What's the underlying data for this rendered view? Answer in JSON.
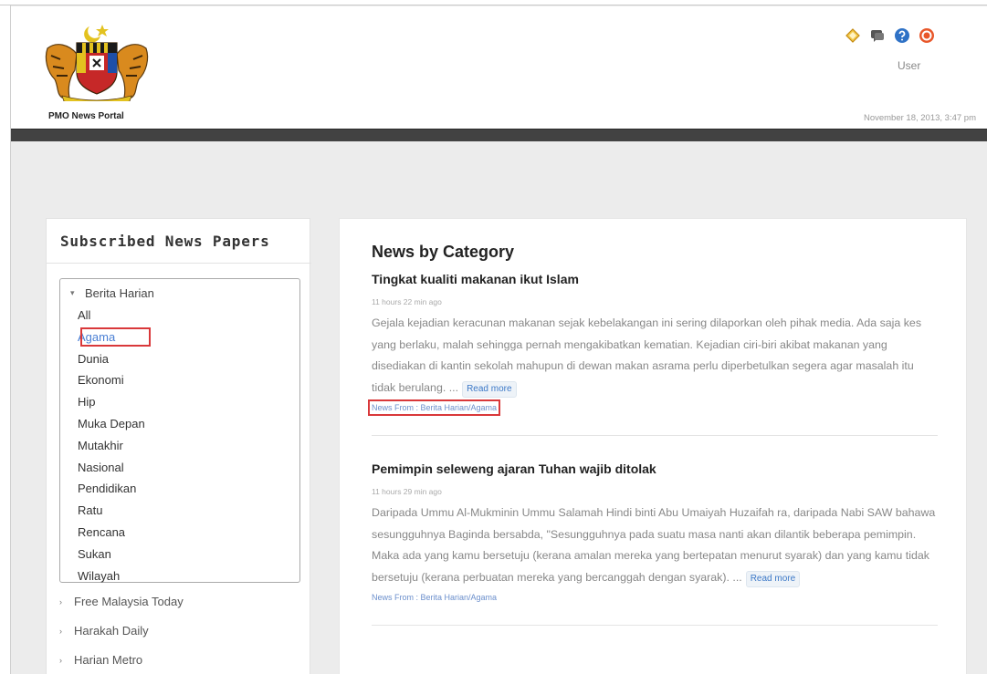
{
  "header": {
    "site_title": "PMO News Portal",
    "user_label": "User",
    "datetime": "November 18, 2013, 3:47 pm",
    "icons": [
      "home-icon",
      "chat-icon",
      "help-icon",
      "logout-icon"
    ]
  },
  "sidebar": {
    "heading": "Subscribed News Papers",
    "expanded_paper": "Berita Harian",
    "categories": [
      "All",
      "Agama",
      "Dunia",
      "Ekonomi",
      "Hip",
      "Muka Depan",
      "Mutakhir",
      "Nasional",
      "Pendidikan",
      "Ratu",
      "Rencana",
      "Sukan",
      "Wilayah"
    ],
    "active_category": "Agama",
    "other_papers": [
      "Free Malaysia Today",
      "Harakah Daily",
      "Harian Metro"
    ]
  },
  "main": {
    "heading": "News by Category",
    "read_more_label": "Read more",
    "articles": [
      {
        "title": "Tingkat kualiti makanan ikut Islam",
        "time": "11 hours 22 min ago",
        "body": "Gejala kejadian keracunan makanan sejak kebelakangan ini sering dilaporkan oleh pihak media. Ada saja kes yang berlaku, malah sehingga pernah mengakibatkan kematian. Kejadian ciri-biri akibat makanan yang disediakan di kantin sekolah mahupun di dewan makan asrama perlu diperbetulkan segera agar masalah itu tidak berulang. ...",
        "source": "News From : Berita Harian/Agama"
      },
      {
        "title": "Pemimpin seleweng ajaran Tuhan wajib ditolak",
        "time": "11 hours 29 min ago",
        "body": "Daripada Ummu Al-Mukminin Ummu Salamah Hindi binti Abu Umaiyah Huzaifah ra, daripada Nabi SAW bahawa sesungguhnya Baginda bersabda, \"Sesungguhnya pada suatu masa nanti akan dilantik beberapa pemimpin. Maka ada yang kamu bersetuju (kerana amalan mereka yang bertepatan menurut syarak) dan yang kamu tidak bersetuju (kerana perbuatan mereka yang bercanggah dengan syarak). ...",
        "source": "News From : Berita Harian/Agama"
      }
    ]
  },
  "colors": {
    "header_bar": "#424242",
    "link_blue": "#4a7fd4",
    "highlight_red": "#d9383a"
  }
}
